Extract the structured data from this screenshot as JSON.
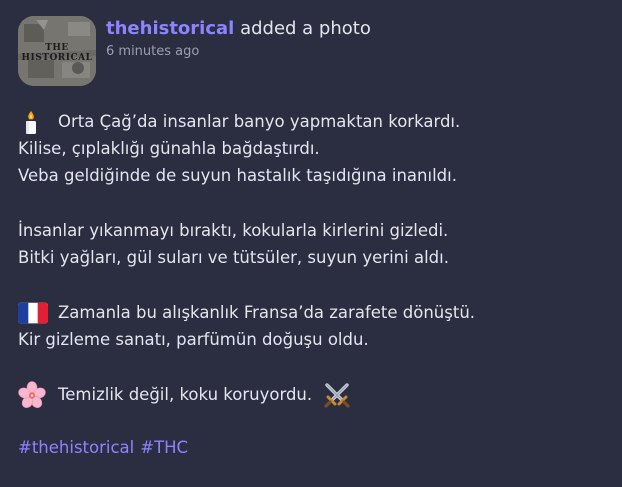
{
  "post": {
    "username": "thehistorical",
    "action": "added a photo",
    "timestamp": "6 minutes ago",
    "avatar_text": "THE HISTORICAL"
  },
  "content": {
    "p1": {
      "icon": "candle-icon",
      "line1": "Orta Çağ’da insanlar banyo yapmaktan korkardı.",
      "line2": "Kilise, çıplaklığı günahla bağdaştırdı.",
      "line3": "Veba geldiğinde de suyun hastalık taşıdığına inanıldı."
    },
    "p2": {
      "line1": "İnsanlar yıkanmayı bıraktı, kokularla kirlerini gizledi.",
      "line2": "Bitki yağları, gül suları ve tütsüler, suyun yerini aldı."
    },
    "p3": {
      "icon": "france-flag-icon",
      "line1": "Zamanla bu alışkanlık Fransa’da zarafete dönüştü.",
      "line2": "Kir gizleme sanatı, parfümün doğuşu oldu."
    },
    "p4": {
      "icon": "cherry-blossom-icon",
      "line1": "Temizlik değil, koku koruyordu.",
      "trailing_icon": "crossed-swords-icon"
    }
  },
  "hashtags": [
    "#thehistorical",
    "#THC"
  ],
  "colors": {
    "background": "#2b2d40",
    "accent": "#8a85ff",
    "text": "#e4e5ee",
    "muted": "#9c9eb0"
  }
}
